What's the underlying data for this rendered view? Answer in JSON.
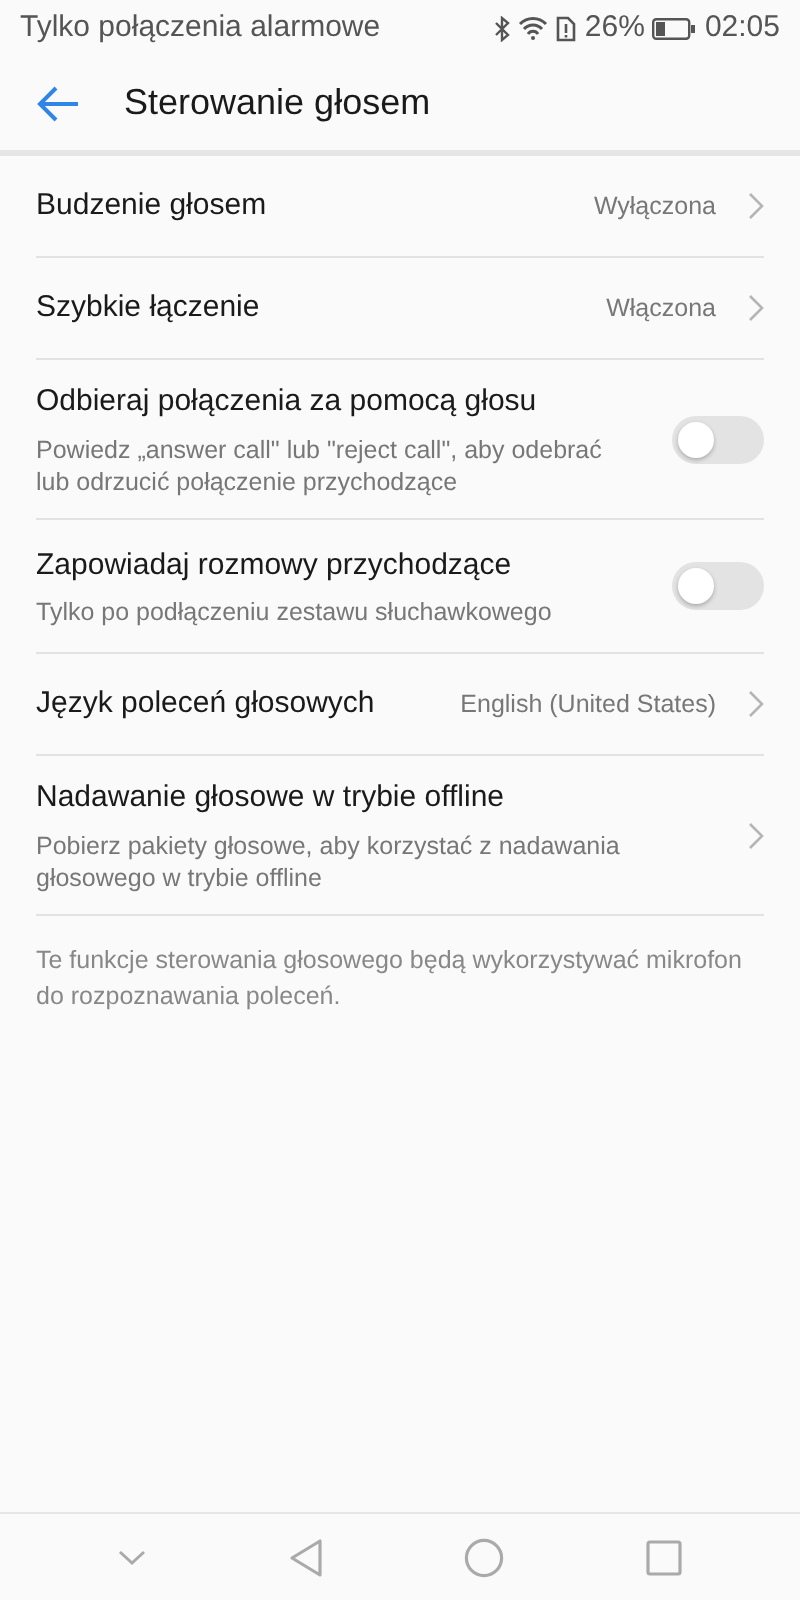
{
  "status_bar": {
    "carrier": "Tylko połączenia alarmowe",
    "battery": "26%",
    "time": "02:05"
  },
  "header": {
    "title": "Sterowanie głosem"
  },
  "items": [
    {
      "kind": "link",
      "title": "Budzenie głosem",
      "value": "Wyłączona"
    },
    {
      "kind": "link",
      "title": "Szybkie łączenie",
      "value": "Włączona"
    },
    {
      "kind": "switch",
      "title": "Odbieraj połączenia za pomocą głosu",
      "subtitle": "Powiedz „answer call\" lub \"reject call\", aby odebrać lub odrzucić połączenie przychodzące",
      "on": false
    },
    {
      "kind": "switch",
      "title": "Zapowiadaj rozmowy przychodzące",
      "subtitle": "Tylko po podłączeniu zestawu słuchawkowego",
      "on": false
    },
    {
      "kind": "link",
      "title": "Język poleceń głosowych",
      "value": "English (United States)"
    },
    {
      "kind": "link",
      "title": "Nadawanie głosowe w trybie offline",
      "subtitle": "Pobierz pakiety głosowe, aby korzystać z nadawania głosowego w trybie offline"
    }
  ],
  "note": "Te funkcje sterowania głosowego będą wykorzystywać mikrofon do rozpoznawania poleceń."
}
